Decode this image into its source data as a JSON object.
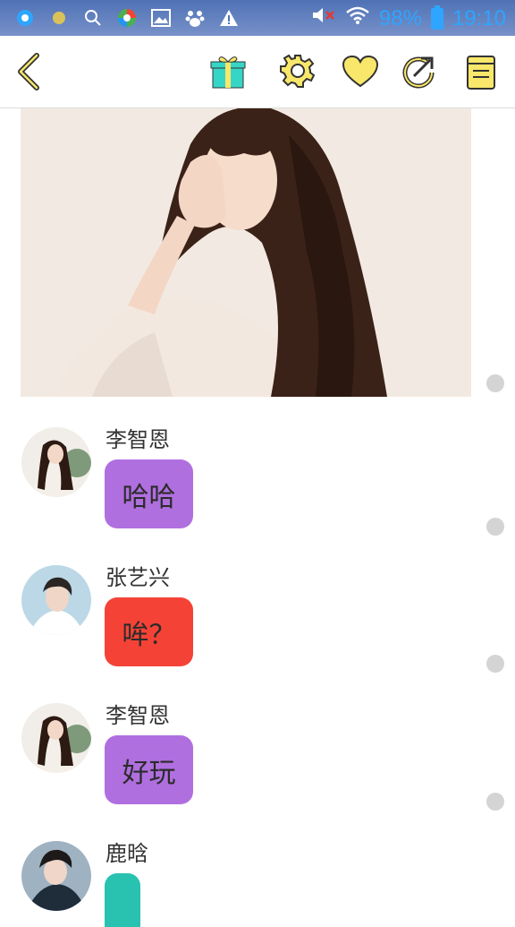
{
  "status_bar": {
    "battery_percent": "98%",
    "time": "19:10",
    "icons": [
      "browser-icon",
      "dot-icon",
      "search-icon",
      "colorwheel-icon",
      "gallery-icon",
      "paw-icon",
      "warning-icon",
      "mute-icon",
      "wifi-icon",
      "battery-icon"
    ]
  },
  "toolbar": {
    "icons": [
      "back-icon",
      "gift-icon",
      "settings-icon",
      "heart-icon",
      "share-icon",
      "notes-icon"
    ],
    "accent": "#f8e76a"
  },
  "messages": [
    {
      "sender": "李智恩",
      "text": "哈哈",
      "bubble_color": "#b06fdf"
    },
    {
      "sender": "张艺兴",
      "text": "哞？",
      "bubble_color": "#f44336"
    },
    {
      "sender": "李智恩",
      "text": "好玩",
      "bubble_color": "#b06fdf"
    },
    {
      "sender": "鹿晗",
      "text": "",
      "bubble_color": "#29c2b0"
    }
  ]
}
